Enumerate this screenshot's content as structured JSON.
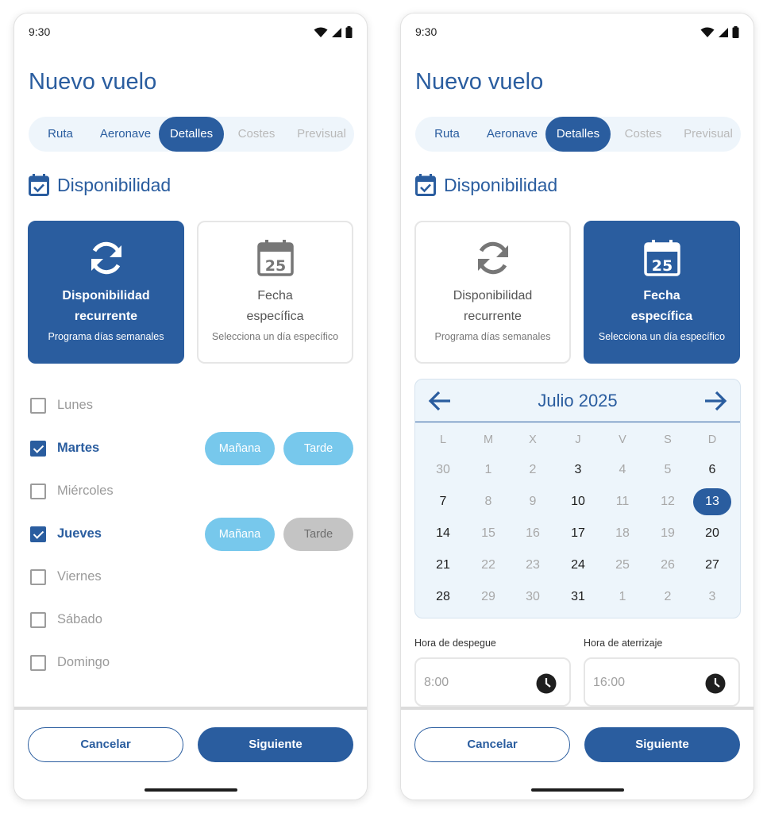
{
  "status": {
    "time": "9:30"
  },
  "title": "Nuevo vuelo",
  "tabs": [
    {
      "label": "Ruta",
      "state": "normal"
    },
    {
      "label": "Aeronave",
      "state": "normal"
    },
    {
      "label": "Detalles",
      "state": "active"
    },
    {
      "label": "Costes",
      "state": "disabled"
    },
    {
      "label": "Previsual",
      "state": "disabled"
    }
  ],
  "section_title": "Disponibilidad",
  "cards": {
    "recurrent": {
      "title_line1": "Disponibilidad",
      "title_line2": "recurrente",
      "subtitle": "Programa días semanales"
    },
    "specific": {
      "title_line1": "Fecha",
      "title_line2": "específica",
      "subtitle": "Selecciona un día específico",
      "icon_number": "25"
    }
  },
  "days": [
    {
      "label": "Lunes",
      "checked": false
    },
    {
      "label": "Martes",
      "checked": true,
      "morning": {
        "label": "Mañana",
        "active": true
      },
      "afternoon": {
        "label": "Tarde",
        "active": true
      }
    },
    {
      "label": "Miércoles",
      "checked": false
    },
    {
      "label": "Jueves",
      "checked": true,
      "morning": {
        "label": "Mañana",
        "active": true
      },
      "afternoon": {
        "label": "Tarde",
        "active": false
      }
    },
    {
      "label": "Viernes",
      "checked": false
    },
    {
      "label": "Sábado",
      "checked": false
    },
    {
      "label": "Domingo",
      "checked": false
    }
  ],
  "calendar": {
    "month_label": "Julio 2025",
    "weekdays": [
      "L",
      "M",
      "X",
      "J",
      "V",
      "S",
      "D"
    ],
    "weeks": [
      [
        {
          "d": "30",
          "m": true
        },
        {
          "d": "1",
          "m": true
        },
        {
          "d": "2",
          "m": true
        },
        {
          "d": "3"
        },
        {
          "d": "4",
          "m": true
        },
        {
          "d": "5",
          "m": true
        },
        {
          "d": "6"
        }
      ],
      [
        {
          "d": "7"
        },
        {
          "d": "8",
          "m": true
        },
        {
          "d": "9",
          "m": true
        },
        {
          "d": "10"
        },
        {
          "d": "11",
          "m": true
        },
        {
          "d": "12",
          "m": true
        },
        {
          "d": "13",
          "s": true
        }
      ],
      [
        {
          "d": "14"
        },
        {
          "d": "15",
          "m": true
        },
        {
          "d": "16",
          "m": true
        },
        {
          "d": "17"
        },
        {
          "d": "18",
          "m": true
        },
        {
          "d": "19",
          "m": true
        },
        {
          "d": "20"
        }
      ],
      [
        {
          "d": "21"
        },
        {
          "d": "22",
          "m": true
        },
        {
          "d": "23",
          "m": true
        },
        {
          "d": "24"
        },
        {
          "d": "25",
          "m": true
        },
        {
          "d": "26",
          "m": true
        },
        {
          "d": "27"
        }
      ],
      [
        {
          "d": "28"
        },
        {
          "d": "29",
          "m": true
        },
        {
          "d": "30",
          "m": true
        },
        {
          "d": "31"
        },
        {
          "d": "1",
          "m": true
        },
        {
          "d": "2",
          "m": true
        },
        {
          "d": "3",
          "m": true
        }
      ]
    ]
  },
  "takeoff": {
    "label": "Hora de despegue",
    "value": "8:00"
  },
  "landing": {
    "label": "Hora de aterrizaje",
    "value": "16:00"
  },
  "buttons": {
    "cancel": "Cancelar",
    "next": "Siguiente"
  },
  "colors": {
    "primary": "#2a5d9f",
    "light_blue": "#77c8ec",
    "gray_pill": "#c4c4c4",
    "calendar_bg": "#edf5fb"
  }
}
